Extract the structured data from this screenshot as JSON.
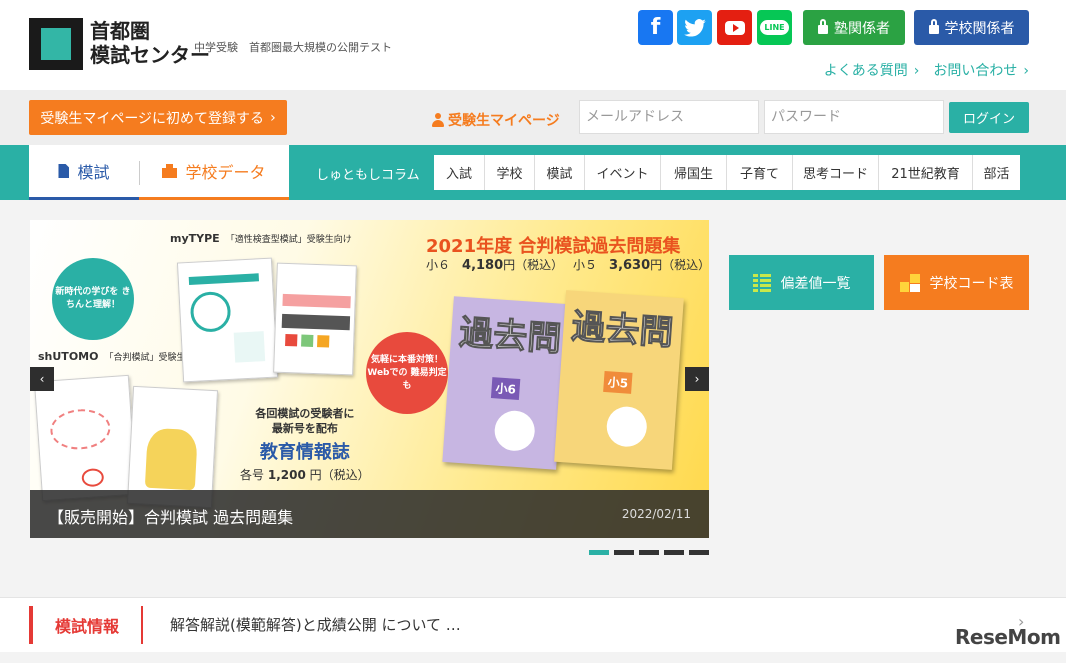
{
  "header": {
    "logo_line1": "首都圏",
    "logo_line2": "模試センター",
    "tagline": "中学受験　首都圏最大規模の公開テスト",
    "social": {
      "facebook_icon": "facebook-icon",
      "twitter_icon": "twitter-icon",
      "youtube_icon": "youtube-icon",
      "line_icon": "line-icon",
      "line_label": "LINE"
    },
    "juku_button": "塾関係者",
    "school_button": "学校関係者",
    "faq_link": "よくある質問",
    "contact_link": "お問い合わせ",
    "chevron": "›"
  },
  "loginbar": {
    "register_button": "受験生マイページに初めて登録する",
    "register_chevron": "›",
    "mypage_label": "受験生マイページ",
    "email_placeholder": "メールアドレス",
    "password_placeholder": "パスワード",
    "login_button": "ログイン"
  },
  "nav": {
    "tab_moshi": "模試",
    "tab_school_data": "学校データ",
    "column_label": "しゅともしコラム",
    "categories": [
      "入試",
      "学校",
      "模試",
      "イベント",
      "帰国生",
      "子育て",
      "思考コード",
      "21世紀教育",
      "部活"
    ]
  },
  "slider": {
    "mytype_title": "myTYPE",
    "mytype_sub": "「適性検査型模試」受験生向け",
    "shutomo_title": "shUTOMO",
    "shutomo_sub": "「合判模試」受験生向け",
    "badge_left": "新時代の学びを きちんと理解！",
    "badge_right": "気軽に本番対策！ Webでの 難易判定も",
    "promo_title": "2021年度 合判模試過去問題集",
    "price_g6_label": "小６",
    "price_g6": "4,180",
    "price_g5_label": "小５",
    "price_g5": "3,630",
    "price_unit": "円（税込）",
    "book6_kanji": "過去問",
    "book6_label": "小6",
    "book5_kanji": "過去問",
    "book5_label": "小5",
    "mag_note_line1": "各回模試の受験者に",
    "mag_note_line2": "最新号を配布",
    "mag_note_title": "教育情報誌",
    "mag_note_price_prefix": "各号",
    "mag_note_price": "1,200",
    "mag_note_price_unit": "円（税込）",
    "caption": "【販売開始】合判模試 過去問題集",
    "date": "2022/02/11",
    "prev_arrow": "‹",
    "next_arrow": "›",
    "active_dot": 1,
    "dot_count": 5
  },
  "side_buttons": {
    "hensa": "偏差値一覧",
    "school_code": "学校コード表"
  },
  "news": {
    "label": "模試情報",
    "text": "解答解説(模範解答)と成績公開 について …",
    "chevron": "›"
  },
  "watermark": "ReseMom",
  "colors": {
    "teal": "#2ab0a5",
    "orange": "#f57c1f",
    "blue": "#2a5aa8",
    "green": "#2ba243",
    "red": "#e53935"
  }
}
